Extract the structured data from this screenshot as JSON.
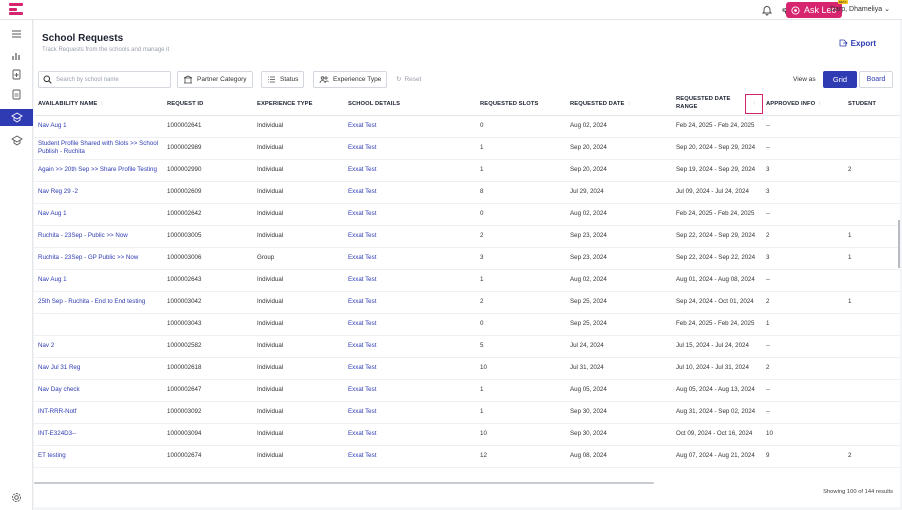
{
  "topbar": {
    "ask_leo": "Ask Leo",
    "beta": "BETA",
    "user_name": "Darp, Dhameliya"
  },
  "page": {
    "title": "School Requests",
    "subtitle": "Track Requests from the schools and manage it",
    "export_label": "Export"
  },
  "filters": {
    "search_placeholder": "Search by school name",
    "partner_category": "Partner Category",
    "status": "Status",
    "experience_type": "Experience Type",
    "reset": "Reset",
    "view_as": "View as",
    "grid": "Grid",
    "board": "Board"
  },
  "table": {
    "columns": [
      "AVAILABILITY NAME",
      "REQUEST ID",
      "EXPERIENCE TYPE",
      "SCHOOL DETAILS",
      "REQUESTED SLOTS",
      "REQUESTED DATE",
      "REQUESTED DATE RANGE",
      "APPROVED INFO",
      "STUDENT"
    ],
    "rows": [
      {
        "name": "Nav Aug 1",
        "id": "1000002641",
        "type": "Individual",
        "school": "Exxat Test",
        "slots": "0",
        "date": "Aug 02, 2024",
        "range": "Feb 24, 2025 - Feb 24, 2025",
        "approved": "--",
        "student": ""
      },
      {
        "name": "Student Profile Shared with Slots >> School Publish - Ruchita",
        "id": "1000002989",
        "type": "Individual",
        "school": "Exxat Test",
        "slots": "1",
        "date": "Sep 20, 2024",
        "range": "Sep 20, 2024 - Sep 29, 2024",
        "approved": "--",
        "student": ""
      },
      {
        "name": "Again >> 20th Sep >> Share Profile Testing",
        "id": "1000002990",
        "type": "Individual",
        "school": "Exxat Test",
        "slots": "1",
        "date": "Sep 20, 2024",
        "range": "Sep 19, 2024 - Sep 29, 2024",
        "approved": "3",
        "student": "2"
      },
      {
        "name": "Nav Reg 29 -2",
        "id": "1000002609",
        "type": "Individual",
        "school": "Exxat Test",
        "slots": "8",
        "date": "Jul 29, 2024",
        "range": "Jul 09, 2024 - Jul 24, 2024",
        "approved": "3",
        "student": ""
      },
      {
        "name": "Nav Aug 1",
        "id": "1000002642",
        "type": "Individual",
        "school": "Exxat Test",
        "slots": "0",
        "date": "Aug 02, 2024",
        "range": "Feb 24, 2025 - Feb 24, 2025",
        "approved": "--",
        "student": ""
      },
      {
        "name": "Ruchita - 23Sep - Public >> Now",
        "id": "1000003005",
        "type": "Individual",
        "school": "Exxat Test",
        "slots": "2",
        "date": "Sep 23, 2024",
        "range": "Sep 22, 2024 - Sep 29, 2024",
        "approved": "2",
        "student": "1"
      },
      {
        "name": "Ruchita - 23Sep - GP Public >> Now",
        "id": "1000003006",
        "type": "Group",
        "school": "Exxat Test",
        "slots": "3",
        "date": "Sep 23, 2024",
        "range": "Sep 22, 2024 - Sep 22, 2024",
        "approved": "3",
        "student": "1"
      },
      {
        "name": "Nav Aug 1",
        "id": "1000002643",
        "type": "Individual",
        "school": "Exxat Test",
        "slots": "1",
        "date": "Aug 02, 2024",
        "range": "Aug 01, 2024 - Aug 08, 2024",
        "approved": "--",
        "student": ""
      },
      {
        "name": "25th Sep - Ruchita - End to End testing",
        "id": "1000003042",
        "type": "Individual",
        "school": "Exxat Test",
        "slots": "2",
        "date": "Sep 25, 2024",
        "range": "Sep 24, 2024 - Oct 01, 2024",
        "approved": "2",
        "student": "1"
      },
      {
        "name": "",
        "id": "1000003043",
        "type": "Individual",
        "school": "Exxat Test",
        "slots": "0",
        "date": "Sep 25, 2024",
        "range": "Feb 24, 2025 - Feb 24, 2025",
        "approved": "1",
        "student": ""
      },
      {
        "name": "Nav 2",
        "id": "1000002582",
        "type": "Individual",
        "school": "Exxat Test",
        "slots": "5",
        "date": "Jul 24, 2024",
        "range": "Jul 15, 2024 - Jul 24, 2024",
        "approved": "--",
        "student": ""
      },
      {
        "name": "Nav Jul 31 Reg",
        "id": "1000002618",
        "type": "Individual",
        "school": "Exxat Test",
        "slots": "10",
        "date": "Jul 31, 2024",
        "range": "Jul 10, 2024 - Jul 31, 2024",
        "approved": "2",
        "student": ""
      },
      {
        "name": "Nav Day check",
        "id": "1000002647",
        "type": "Individual",
        "school": "Exxat Test",
        "slots": "1",
        "date": "Aug 05, 2024",
        "range": "Aug 05, 2024 - Aug 13, 2024",
        "approved": "--",
        "student": ""
      },
      {
        "name": "INT-RRR-Notf",
        "id": "1000003092",
        "type": "Individual",
        "school": "Exxat Test",
        "slots": "1",
        "date": "Sep 30, 2024",
        "range": "Aug 31, 2024 - Sep 02, 2024",
        "approved": "--",
        "student": ""
      },
      {
        "name": "INT-E324D3--",
        "id": "1000003094",
        "type": "Individual",
        "school": "Exxat Test",
        "slots": "10",
        "date": "Sep 30, 2024",
        "range": "Oct 09, 2024 - Oct 16, 2024",
        "approved": "10",
        "student": ""
      },
      {
        "name": "ET testing",
        "id": "1000002674",
        "type": "Individual",
        "school": "Exxat Test",
        "slots": "12",
        "date": "Aug 08, 2024",
        "range": "Aug 07, 2024 - Aug 21, 2024",
        "approved": "9",
        "student": "2"
      }
    ]
  },
  "footer": {
    "results": "Showing 100 of 144 results"
  }
}
